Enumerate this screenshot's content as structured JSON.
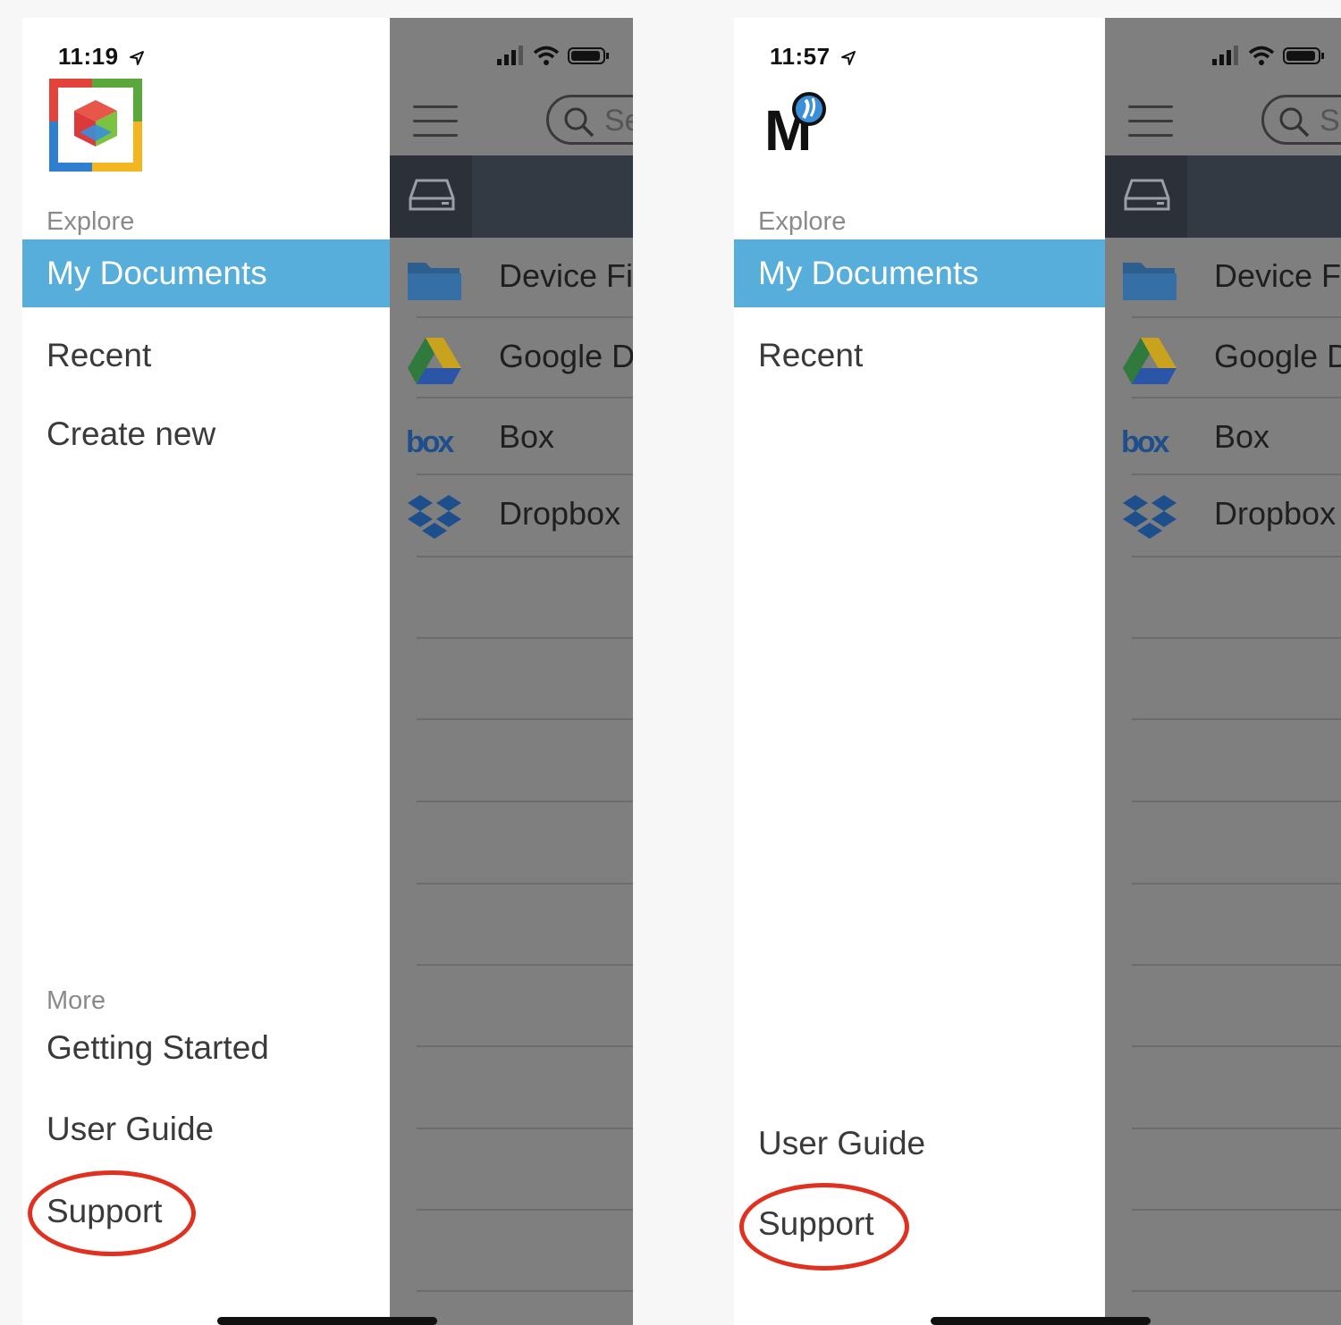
{
  "screens": [
    {
      "status": {
        "time": "11:19"
      },
      "menu": {
        "explore_label": "Explore",
        "explore_items": [
          "My Documents",
          "Recent",
          "Create new"
        ],
        "more_label": "More",
        "more_items": [
          "Getting Started",
          "User Guide",
          "Support"
        ],
        "active_item": "My Documents",
        "highlighted_item": "Support"
      },
      "main": {
        "search_placeholder": "Se",
        "sources": [
          "Device Fil",
          "Google D",
          "Box",
          "Dropbox"
        ]
      }
    },
    {
      "status": {
        "time": "11:57"
      },
      "menu": {
        "explore_label": "Explore",
        "explore_items": [
          "My Documents",
          "Recent"
        ],
        "more_items": [
          "User Guide",
          "Support"
        ],
        "active_item": "My Documents",
        "highlighted_item": "Support"
      },
      "main": {
        "search_placeholder": "Se",
        "sources": [
          "Device Fi",
          "Google D",
          "Box",
          "Dropbox"
        ]
      }
    }
  ],
  "colors": {
    "active_menu": "#58aedb",
    "highlight_ring": "#e0301f",
    "overlay": "#7f7f7f",
    "source_bar": "#343a44"
  },
  "icons": [
    "location-arrow-icon",
    "app-logo-icon",
    "signal-icon",
    "wifi-icon",
    "battery-icon",
    "hamburger-icon",
    "search-icon",
    "drive-icon",
    "folder-icon",
    "google-drive-icon",
    "box-icon",
    "dropbox-icon"
  ]
}
